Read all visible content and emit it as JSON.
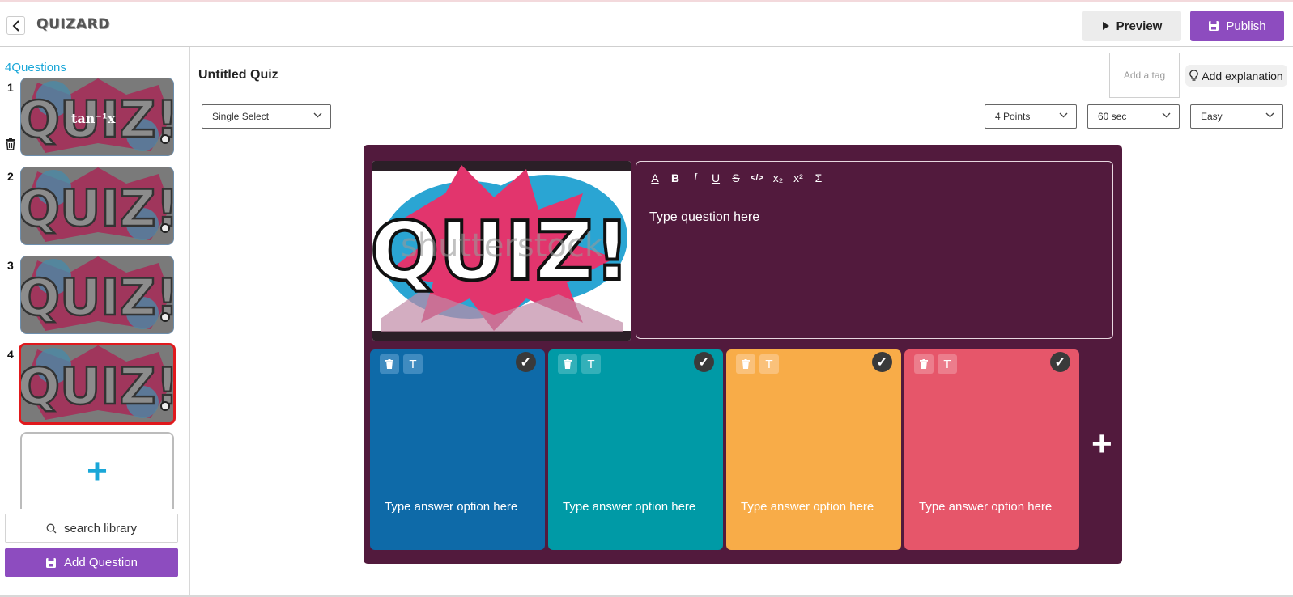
{
  "header": {
    "logo": "QUIZARD",
    "preview_label": "Preview",
    "publish_label": "Publish"
  },
  "sidebar": {
    "question_count": "4Questions",
    "thumbnails": [
      {
        "number": "1",
        "overlay": "tan⁻¹x"
      },
      {
        "number": "2",
        "overlay": ""
      },
      {
        "number": "3",
        "overlay": ""
      },
      {
        "number": "4",
        "overlay": ""
      }
    ],
    "add_card_symbol": "+",
    "search_label": "search library",
    "add_question_label": "Add Question"
  },
  "main": {
    "quiz_title": "Untitled Quiz",
    "tag_placeholder": "Add a tag",
    "explanation_label": "Add explanation",
    "question_type": "Single Select",
    "points": "4 Points",
    "time": "60 sec",
    "difficulty": "Easy"
  },
  "editor": {
    "media_text": "QUIZ!",
    "watermark": "shutterstock",
    "question_placeholder": "Type question here",
    "toolbar": [
      "A",
      "B",
      "I",
      "U",
      "S",
      "</>",
      "x₂",
      "x²",
      "Σ"
    ],
    "add_option_symbol": "+",
    "options": [
      {
        "text": "Type answer option here",
        "color": "#0e6aa8"
      },
      {
        "text": "Type answer option here",
        "color": "#009aa6"
      },
      {
        "text": "Type answer option here",
        "color": "#f8ac48"
      },
      {
        "text": "Type answer option here",
        "color": "#e6566a"
      }
    ],
    "option_tool_label": "T",
    "check_mark": "✓"
  },
  "colors": {
    "accent": "#8d4cbf",
    "editor_bg": "#521a3d",
    "link_blue": "#1aa7d8",
    "active_border": "#e0191d"
  }
}
